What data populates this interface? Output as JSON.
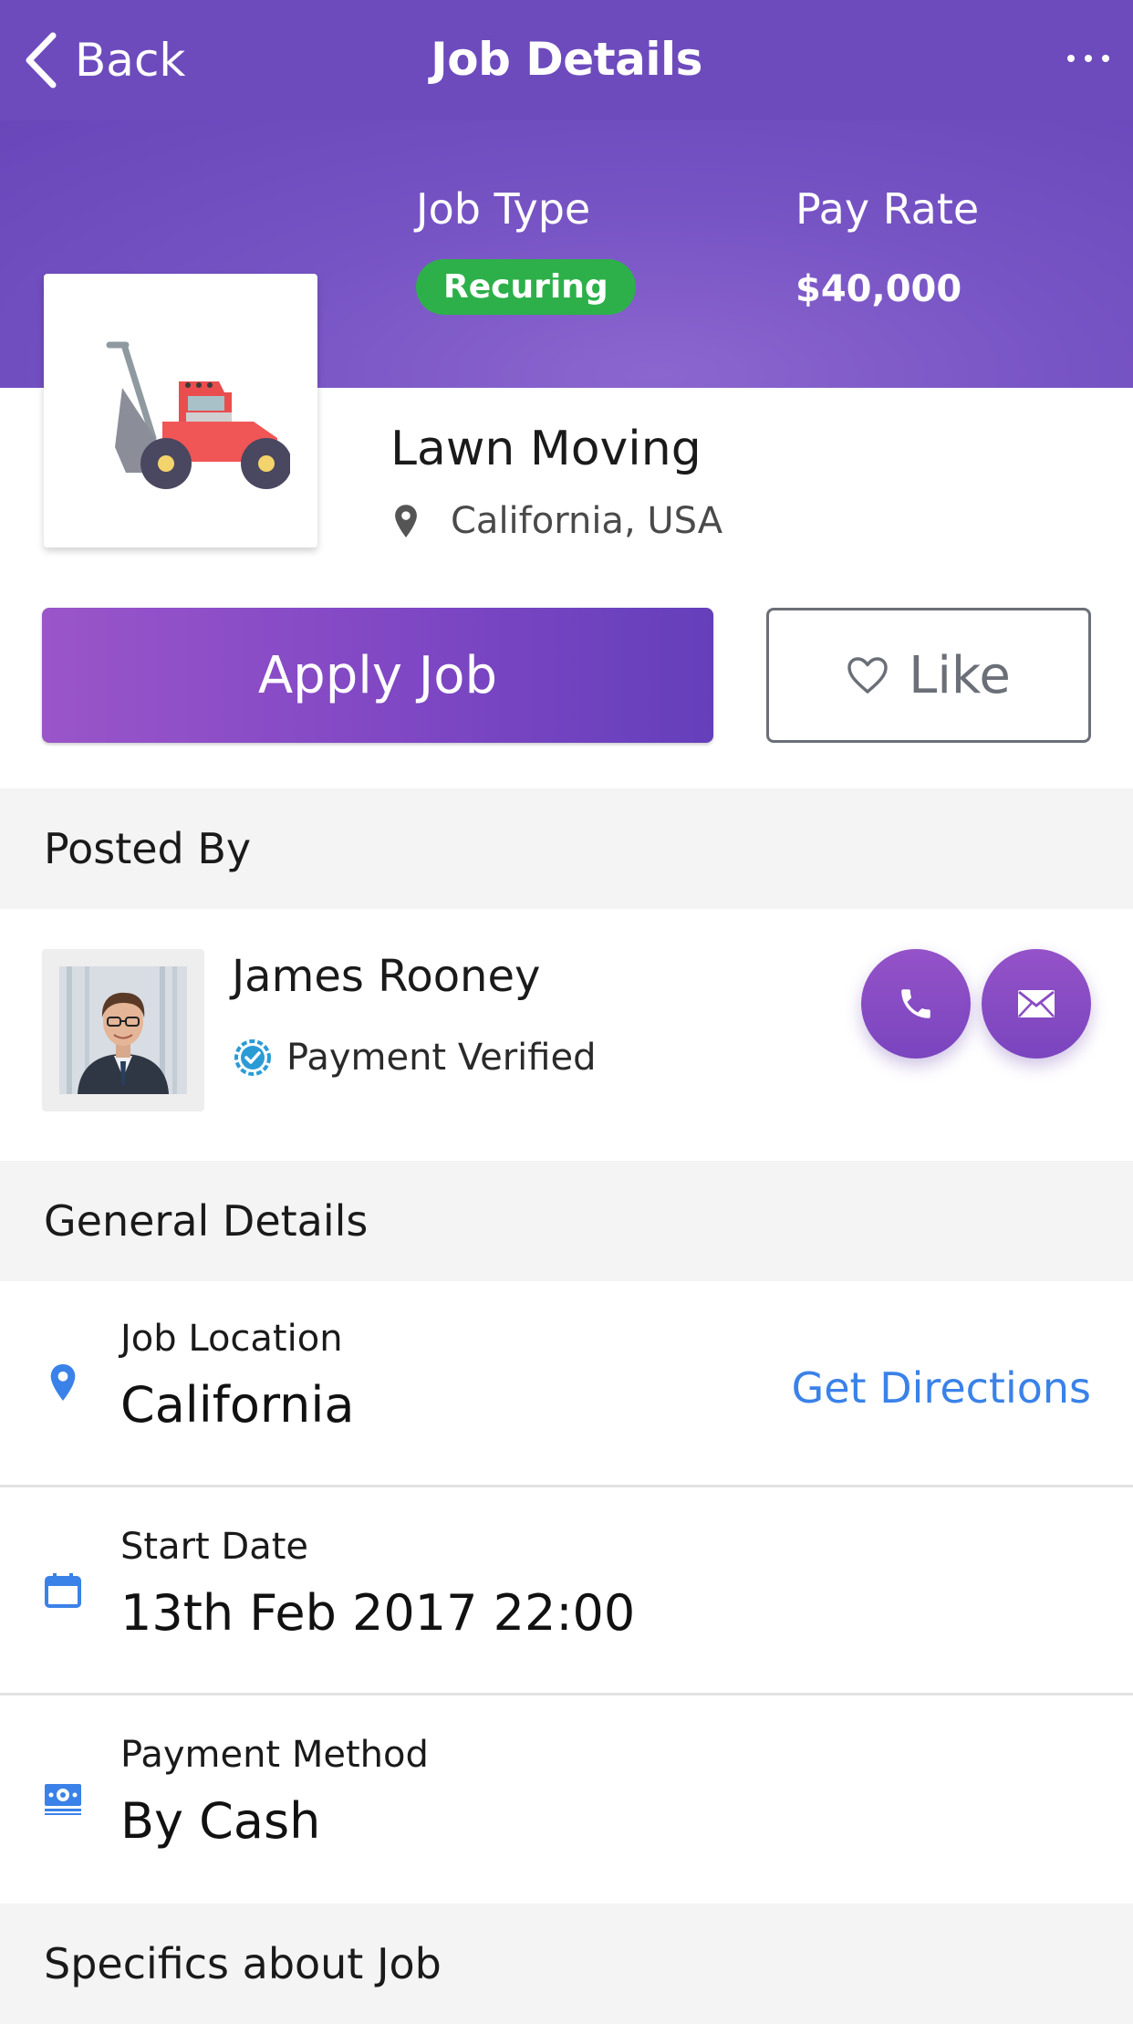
{
  "nav": {
    "back_label": "Back",
    "title": "Job Details"
  },
  "job": {
    "type_label": "Job Type",
    "type_value": "Recuring",
    "pay_label": "Pay Rate",
    "pay_value": "$40,000",
    "title": "Lawn Moving",
    "location": "California, USA"
  },
  "actions": {
    "apply_label": "Apply Job",
    "like_label": "Like"
  },
  "posted_by": {
    "header": "Posted By",
    "name": "James Rooney",
    "status": "Payment Verified"
  },
  "general": {
    "header": "General Details",
    "rows": [
      {
        "label": "Job Location",
        "value": "California",
        "action": "Get Directions"
      },
      {
        "label": "Start Date",
        "value": "13th Feb 2017 22:00"
      },
      {
        "label": "Payment Method",
        "value": "By Cash"
      }
    ]
  },
  "specifics": {
    "header": "Specifics about Job"
  },
  "colors": {
    "primary": "#6d4bbd",
    "badge_green": "#2db04a",
    "link_blue": "#3a82e8"
  },
  "icons": [
    "chevron-left-icon",
    "more-dots-icon",
    "lawn-mower-icon",
    "pin-icon",
    "heart-icon",
    "verified-icon",
    "phone-icon",
    "mail-icon",
    "location-pin-icon",
    "calendar-icon",
    "cash-icon"
  ]
}
